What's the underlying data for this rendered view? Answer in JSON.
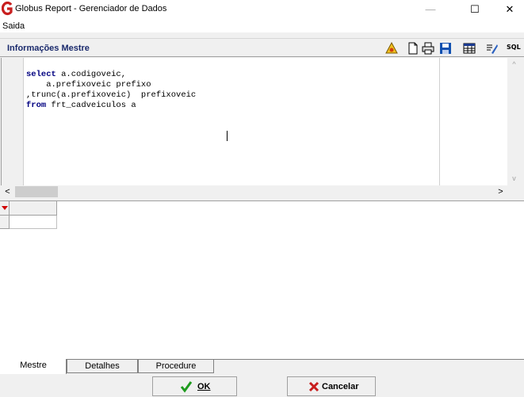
{
  "window": {
    "title": "Globus Report - Gerenciador de Dados",
    "minimize": "—",
    "maximize": "☐",
    "close": "✕"
  },
  "menu": {
    "items": [
      "Saida"
    ]
  },
  "panel": {
    "title": "Informações Mestre",
    "toolbar_icons": [
      "run-query-icon",
      "new-document-icon",
      "print-icon",
      "save-icon",
      "grid-view-icon",
      "edit-icon",
      "sql-icon"
    ],
    "sql_label": "SQL"
  },
  "editor": {
    "lines": [
      {
        "kw": "select",
        "rest": " a.codigoveic,"
      },
      {
        "kw": "",
        "rest": "    a.prefixoveic prefixo"
      },
      {
        "kw": "",
        "rest": ",trunc(a.prefixoveic)  prefixoveic"
      },
      {
        "kw": "from",
        "rest": " frt_cadveiculos a"
      }
    ]
  },
  "scrollbars": {
    "left": "<",
    "right": ">",
    "up": "^",
    "down": "v"
  },
  "tabs": [
    {
      "label": "Mestre",
      "active": true
    },
    {
      "label": "Detalhes",
      "active": false
    },
    {
      "label": "Procedure",
      "active": false
    }
  ],
  "buttons": {
    "ok": "OK",
    "cancel": "Cancelar"
  },
  "colors": {
    "title_accent": "#c81e1e",
    "panel_title": "#1a2a6c",
    "ok_check": "#1e9b1e",
    "cancel_x": "#c81e1e"
  }
}
